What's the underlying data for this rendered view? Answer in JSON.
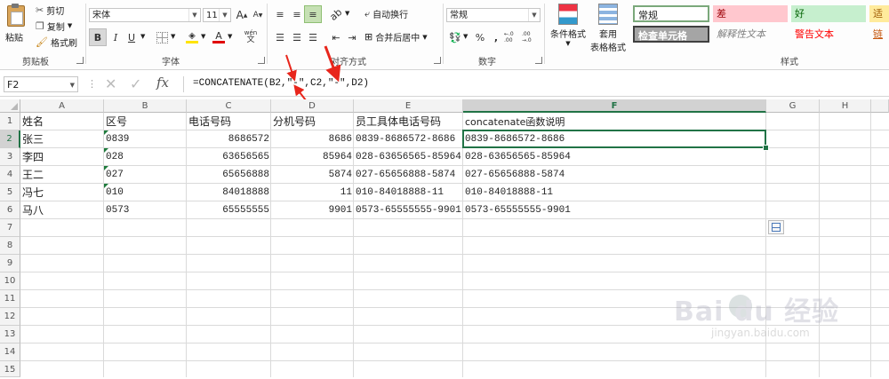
{
  "ribbon": {
    "clipboard": {
      "paste": "粘贴",
      "cut": "剪切",
      "copy": "复制",
      "format_painter": "格式刷",
      "group": "剪贴板"
    },
    "font": {
      "name": "宋体",
      "size": "11",
      "bold": "B",
      "italic": "I",
      "underline": "U",
      "group": "字体",
      "grow": "A",
      "shrink": "A",
      "wen": "wén",
      "font_color": "#e00000",
      "fill_color": "#ffe400"
    },
    "alignment": {
      "wrap": "自动换行",
      "merge": "合并后居中",
      "group": "对齐方式"
    },
    "number": {
      "format": "常规",
      "percent": "%",
      "comma": ",",
      "inc_dec": "←.0 .00",
      "dec_dec": ".00 →.0",
      "group": "数字"
    },
    "styles": {
      "conditional": "条件格式",
      "table_format_1": "套用",
      "table_format_2": "表格格式",
      "normal": "常规",
      "bad": "差",
      "good": "好",
      "neutral": "适中",
      "check_cell": "检查单元格",
      "explanatory": "解释性文本",
      "warning": "警告文本",
      "link": "链接",
      "group": "样式"
    }
  },
  "formula_bar": {
    "name_box": "F2",
    "fx": "fx",
    "formula": "=CONCATENATE(B2,\"-\",C2,\"-\",D2)"
  },
  "sheet": {
    "columns": [
      "A",
      "B",
      "C",
      "D",
      "E",
      "F",
      "G",
      "H"
    ],
    "rows": [
      "1",
      "2",
      "3",
      "4",
      "5",
      "6",
      "7",
      "8",
      "9",
      "10",
      "11",
      "12",
      "13",
      "14",
      "15"
    ],
    "selected_cell": "F2",
    "header_row": [
      "姓名",
      "区号",
      "电话号码",
      "分机号码",
      "员工具体电话号码",
      "concatenate函数说明"
    ],
    "data": [
      [
        "张三",
        "0839",
        "8686572",
        "8686",
        "0839-8686572-8686",
        "0839-8686572-8686"
      ],
      [
        "李四",
        "028",
        "63656565",
        "85964",
        "028-63656565-85964",
        "028-63656565-85964"
      ],
      [
        "王二",
        "027",
        "65656888",
        "5874",
        "027-65656888-5874",
        "027-65656888-5874"
      ],
      [
        "冯七",
        "010",
        "84018888",
        "11",
        "010-84018888-11",
        "010-84018888-11"
      ],
      [
        "马八",
        "0573",
        "65555555",
        "9901",
        "0573-65555555-9901",
        "0573-65555555-9901"
      ]
    ]
  },
  "watermark": {
    "brand": "Bai du 经验",
    "url": "jingyan.baidu.com"
  },
  "colors": {
    "accent": "#217346",
    "arrow": "#e8261c"
  }
}
